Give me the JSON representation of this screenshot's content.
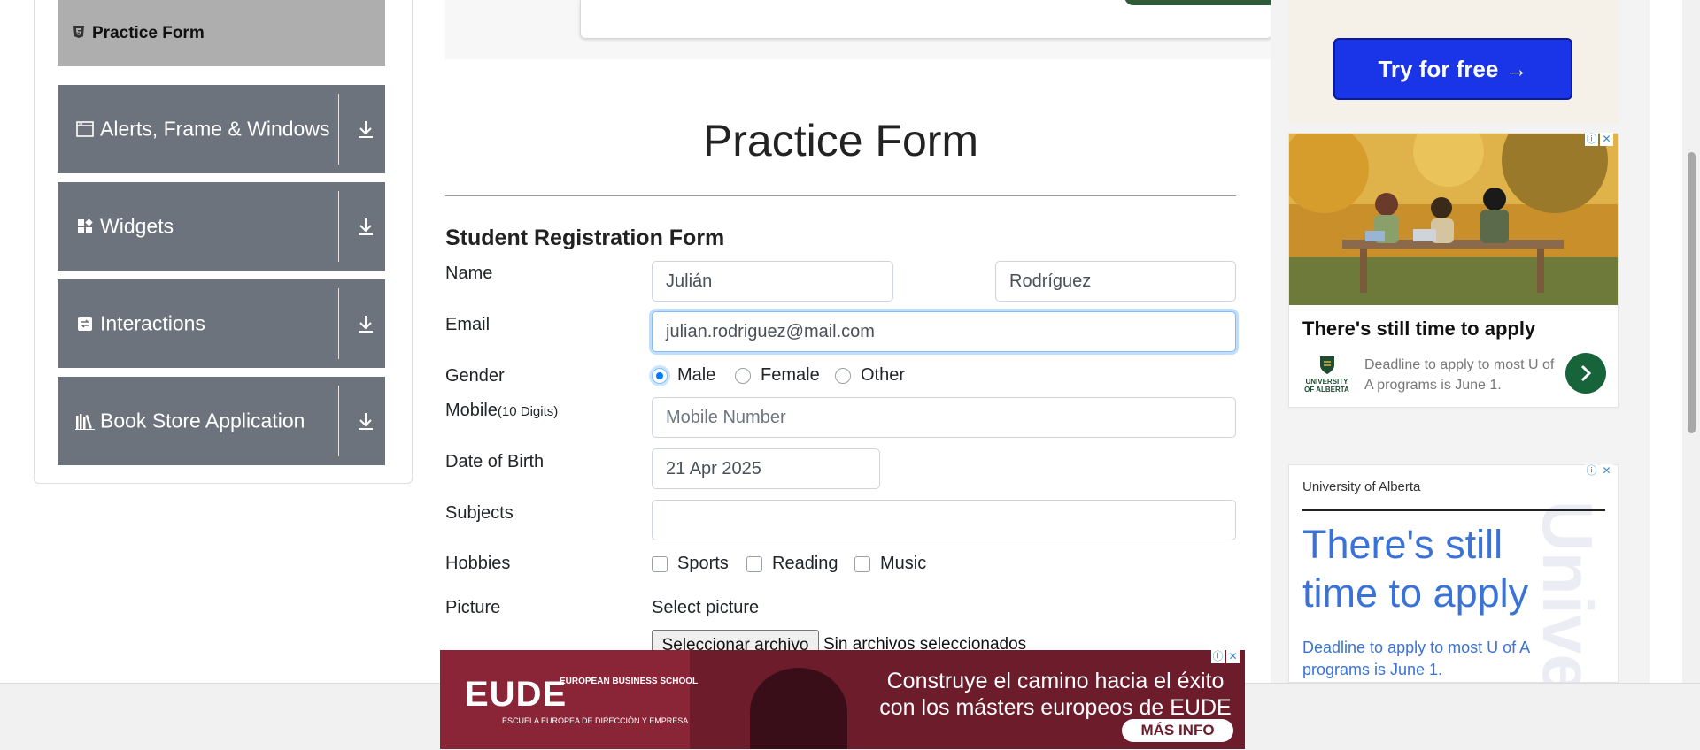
{
  "sidebar": {
    "active_item": {
      "label": "Practice Form",
      "icon": "html5-icon"
    },
    "groups": [
      {
        "label": "Alerts, Frame & Windows",
        "icon": "window-icon"
      },
      {
        "label": "Widgets",
        "icon": "widgets-icon"
      },
      {
        "label": "Interactions",
        "icon": "interactions-icon"
      },
      {
        "label": "Book Store Application",
        "icon": "books-icon"
      }
    ]
  },
  "main": {
    "page_title": "Practice Form",
    "form_title": "Student Registration Form",
    "labels": {
      "name": "Name",
      "email": "Email",
      "gender": "Gender",
      "mobile": "Mobile",
      "mobile_hint": "(10 Digits)",
      "dob": "Date of Birth",
      "subjects": "Subjects",
      "hobbies": "Hobbies",
      "picture": "Picture"
    },
    "fields": {
      "first_name": "Julián",
      "last_name": "Rodríguez",
      "email": "julian.rodriguez@mail.com",
      "mobile_placeholder": "Mobile Number",
      "dob": "21 Apr 2025",
      "subjects": ""
    },
    "gender_options": [
      {
        "label": "Male",
        "selected": true
      },
      {
        "label": "Female",
        "selected": false
      },
      {
        "label": "Other",
        "selected": false
      }
    ],
    "hobby_options": [
      {
        "label": "Sports",
        "checked": false
      },
      {
        "label": "Reading",
        "checked": false
      },
      {
        "label": "Music",
        "checked": false
      }
    ],
    "picture": {
      "select_label": "Select picture",
      "button": "Seleccionar archivo",
      "status": "Sin archivos seleccionados"
    }
  },
  "ads": {
    "top_button": "Try for free →",
    "ad1": {
      "headline": "There's still time to apply",
      "sub": "Deadline to apply to most U of A programs is June 1.",
      "logo": "UNIVERSITY OF ALBERTA"
    },
    "ad2": {
      "org": "University of Alberta",
      "headline": "There's still time to apply",
      "sub": "Deadline to apply to most U of A programs is June 1."
    },
    "bottom": {
      "brand": "EUDE",
      "brand_sub": "EUROPEAN BUSINESS SCHOOL",
      "brand_line": "ESCUELA EUROPEA DE DIRECCIÓN Y EMPRESA",
      "message": "Construye el camino hacia el éxito con los másters europeos de EUDE",
      "cta": "MÁS INFO"
    },
    "ad_choices_icon": "ⓘ",
    "ad_close_icon": "✕"
  },
  "colors": {
    "sidebar_active": "#aeaeae",
    "sidebar_group": "#6c737c",
    "focus_blue": "#80bdff",
    "ad_blue": "#3a73d8",
    "ad_green": "#17643a",
    "eude_red": "#6d1c2c"
  }
}
